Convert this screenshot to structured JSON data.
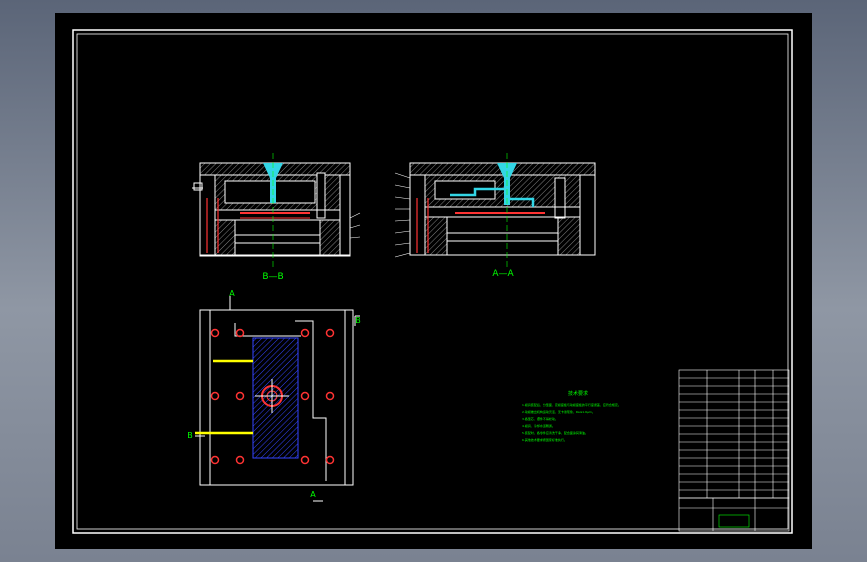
{
  "drawing": {
    "views": {
      "section_bb": {
        "label": "B—B"
      },
      "section_aa": {
        "label": "A—A"
      },
      "plan": {
        "marker_a": "A",
        "marker_b": "B"
      }
    },
    "technical_requirements": {
      "title": "技术要求",
      "lines": [
        "1.模具装配后，分型面、定模座板与动模座板的平行度误差，应符合规定。",
        "2.动模推出机构运动灵活，无卡滞现象，Ra≤1.6μm。",
        "3.各型芯、镶件不得松动。",
        "4.模具、冷却水道畅通。",
        "5.装配时，各零件应清洗干净，配合面涂润滑油。",
        "6.其他技术要求按国家标准执行。"
      ]
    },
    "colors": {
      "background": "#000000",
      "frame": "#ffffff",
      "cavity": "#33d6e6",
      "dimension": "#00ff00",
      "pin": "#ff3333",
      "highlight": "#ffff00",
      "hatch": "#2233ff"
    }
  }
}
